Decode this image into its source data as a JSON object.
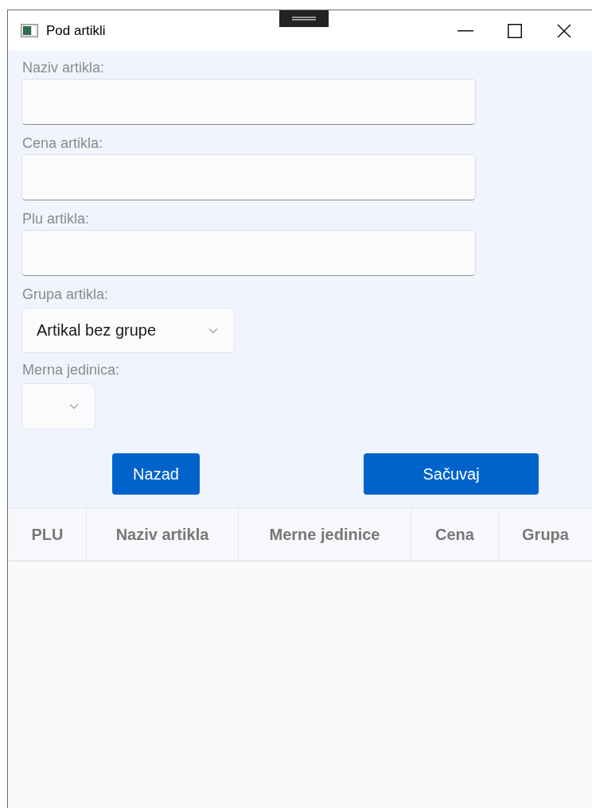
{
  "window": {
    "title": "Pod artikli"
  },
  "fields": [
    {
      "label": "Naziv artikla:"
    },
    {
      "label": "Cena artikla:"
    },
    {
      "label": "Plu artikla:"
    }
  ],
  "selects": [
    {
      "label": "Grupa artikla:",
      "value": "Artikal bez grupe",
      "kind": "wide"
    },
    {
      "label": "Merna jedinica:",
      "kind": "narrow"
    }
  ],
  "buttons": [
    {
      "label": "Nazad",
      "kind": "back"
    },
    {
      "label": "Sačuvaj",
      "kind": "save"
    }
  ],
  "table": {
    "columns": [
      "PLU",
      "Naziv artikla",
      "Merne jedinice",
      "Cena",
      "Grupa"
    ]
  }
}
